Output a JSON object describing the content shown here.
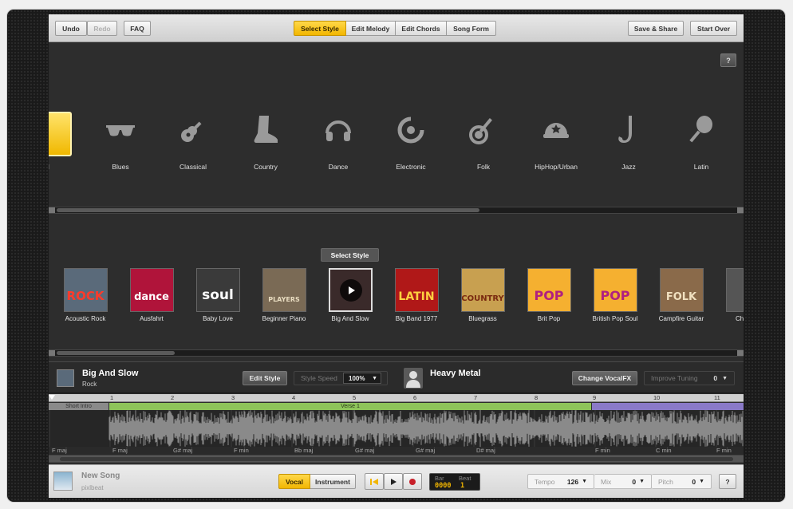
{
  "toolbar": {
    "undo": "Undo",
    "redo": "Redo",
    "faq": "FAQ",
    "tabs": [
      "Select Style",
      "Edit Melody",
      "Edit Chords",
      "Song Form"
    ],
    "save_share": "Save & Share",
    "start_over": "Start Over"
  },
  "help_label": "?",
  "genres": {
    "selected_partial_label": "ll",
    "items": [
      {
        "label": "Blues",
        "icon": "sunglasses-icon"
      },
      {
        "label": "Classical",
        "icon": "guitar-icon"
      },
      {
        "label": "Country",
        "icon": "cowboy-boot-icon"
      },
      {
        "label": "Dance",
        "icon": "headphones-icon"
      },
      {
        "label": "Electronic",
        "icon": "vinyl-icon"
      },
      {
        "label": "Folk",
        "icon": "banjo-icon"
      },
      {
        "label": "HipHop/Urban",
        "icon": "cap-icon"
      },
      {
        "label": "Jazz",
        "icon": "saxophone-icon"
      },
      {
        "label": "Latin",
        "icon": "maraca-icon"
      }
    ]
  },
  "styles": {
    "select_tooltip": "Select Style",
    "items": [
      {
        "label": "Acoustic Rock",
        "art": "ROCK",
        "bg": "#5a6a7a",
        "fg": "#ff3a2a"
      },
      {
        "label": "Ausfahrt",
        "art": "dance",
        "bg": "#b0143a",
        "fg": "#ffffff"
      },
      {
        "label": "Baby Love",
        "art": "soul",
        "bg": "#3a3a3a",
        "fg": "#ffffff"
      },
      {
        "label": "Beginner Piano",
        "art": "PLAYERS",
        "bg": "#7a6a55",
        "fg": "#e8dcc0"
      },
      {
        "label": "Big And Slow",
        "art": "",
        "bg": "#3a2a2a",
        "fg": "#ffffff"
      },
      {
        "label": "Big Band 1977",
        "art": "LATIN",
        "bg": "#b01818",
        "fg": "#ffd040"
      },
      {
        "label": "Bluegrass",
        "art": "COUNTRY",
        "bg": "#c8a050",
        "fg": "#7a2a10"
      },
      {
        "label": "Brit Pop",
        "art": "POP",
        "bg": "#f5b030",
        "fg": "#b02080"
      },
      {
        "label": "British Pop Soul",
        "art": "POP",
        "bg": "#f5b030",
        "fg": "#b02080"
      },
      {
        "label": "Campfire Guitar",
        "art": "FOLK",
        "bg": "#8a6a4a",
        "fg": "#f0e0c0"
      },
      {
        "label": "Ch",
        "art": "",
        "bg": "#555555",
        "fg": "#ffffff"
      }
    ]
  },
  "current": {
    "style_name": "Big And Slow",
    "style_genre": "Rock",
    "edit_style": "Edit Style",
    "style_speed_label": "Style Speed",
    "style_speed_value": "100%",
    "vocal_fx_name": "Heavy Metal",
    "change_vocalfx": "Change VocalFX",
    "improve_tuning_label": "Improve Tuning",
    "improve_tuning_value": "0"
  },
  "timeline": {
    "bars": [
      "1",
      "2",
      "3",
      "4",
      "5",
      "6",
      "7",
      "8",
      "9",
      "10",
      "11"
    ],
    "sections": [
      {
        "label": "Short Intro",
        "color": "#9a9a9a"
      },
      {
        "label": "Verse 1",
        "color": "#8ec45a"
      },
      {
        "label": "",
        "color": "#8a7ac8"
      }
    ],
    "chords": [
      "F maj",
      "F maj",
      "G# maj",
      "F min",
      "Bb maj",
      "G# maj",
      "G# maj",
      "D# maj",
      "F min",
      "C min",
      "F min"
    ]
  },
  "bottom": {
    "song_title": "New Song",
    "song_author": "pixlbeat",
    "vocal": "Vocal",
    "instrument": "Instrument",
    "bar_label": "Bar",
    "beat_label": "Beat",
    "bar_value": "0000",
    "beat_value": "1",
    "tempo_label": "Tempo",
    "tempo_value": "126",
    "mix_label": "Mix",
    "mix_value": "0",
    "pitch_label": "Pitch",
    "pitch_value": "0",
    "help": "?"
  },
  "colors": {
    "accent": "#f2b600",
    "panel": "#2d2d2d"
  }
}
